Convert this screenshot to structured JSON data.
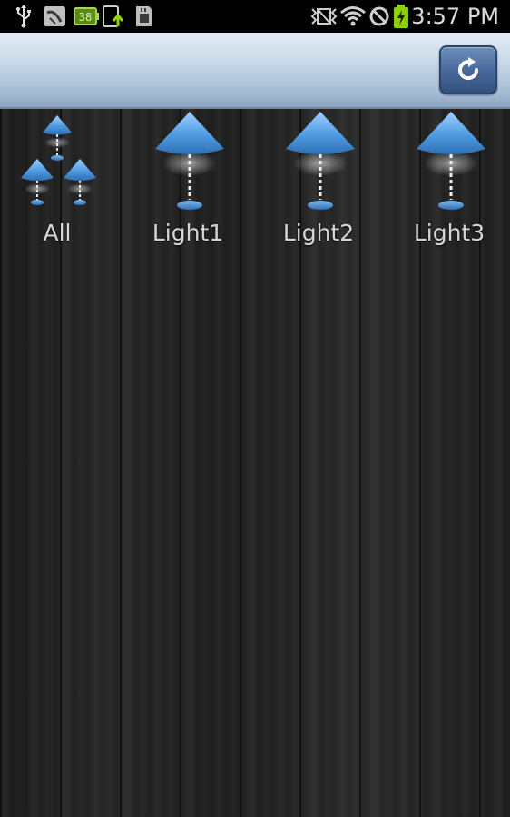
{
  "status_bar": {
    "time": "3:57 PM",
    "icons": [
      "usb-icon",
      "gallery-icon",
      "battery-monitor-icon",
      "upload-icon",
      "sd-card-icon",
      "vibrate-icon",
      "wifi-icon",
      "no-signal-icon",
      "battery-charging-icon"
    ]
  },
  "action_bar": {
    "refresh_icon": "refresh-icon"
  },
  "lights": [
    {
      "label": "All",
      "icon": "all-lamps-icon"
    },
    {
      "label": "Light1",
      "icon": "lamp-icon"
    },
    {
      "label": "Light2",
      "icon": "lamp-icon"
    },
    {
      "label": "Light3",
      "icon": "lamp-icon"
    }
  ],
  "colors": {
    "lamp_blue": "#4f9be0",
    "action_bar_light": "#e4edf6",
    "action_bar_dark": "#8ea6c2",
    "label_text": "#d6d6d6",
    "battery_green": "#8ed100"
  }
}
